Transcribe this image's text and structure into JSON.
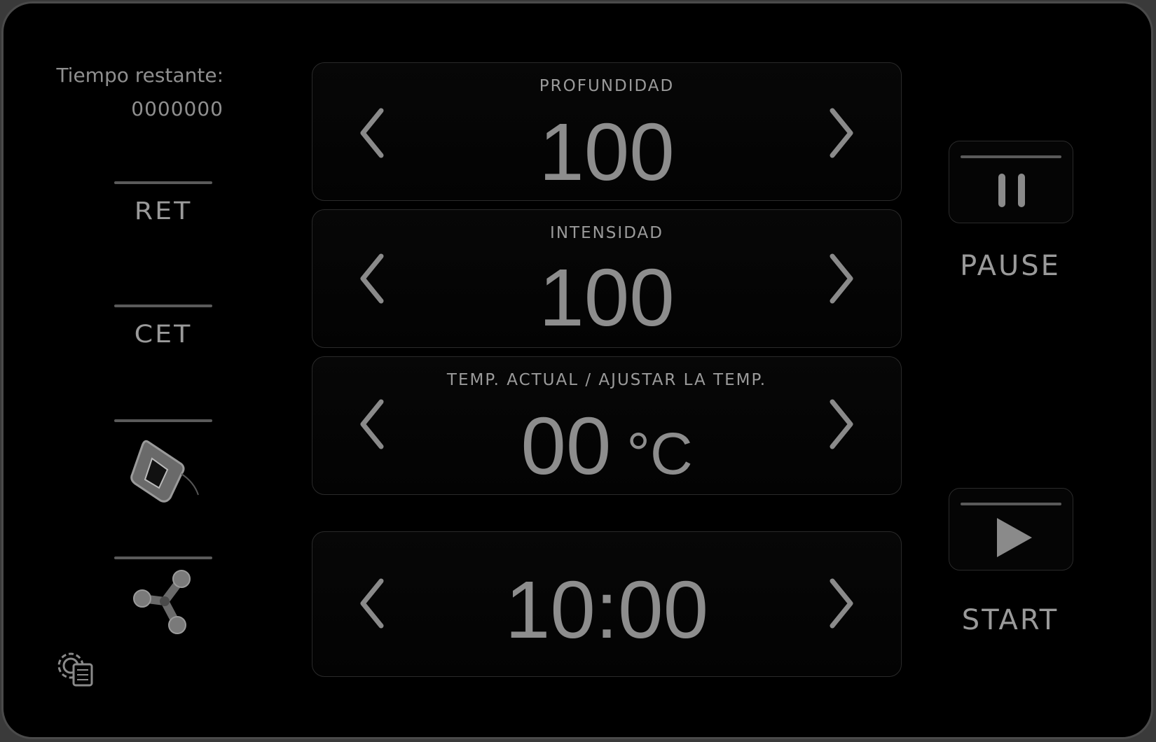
{
  "timer": {
    "label": "Tiempo restante:",
    "value": "0000000"
  },
  "modes": [
    {
      "label": "RET"
    },
    {
      "label": "CET"
    },
    {
      "icon": "handpiece-icon"
    },
    {
      "icon": "tripolar-applicator-icon"
    }
  ],
  "panels": {
    "depth": {
      "label": "PROFUNDIDAD",
      "value": "100"
    },
    "intensity": {
      "label": "INTENSIDAD",
      "value": "100"
    },
    "temperature": {
      "label": "TEMP. ACTUAL / AJUSTAR LA TEMP.",
      "value": "00",
      "unit": "°C"
    },
    "time": {
      "value": "10:00"
    }
  },
  "controls": {
    "pause": {
      "label": "PAUSE",
      "icon": "pause-icon"
    },
    "start": {
      "label": "START",
      "icon": "play-icon"
    }
  },
  "settings": {
    "icon": "settings-gear-icon"
  },
  "colors": {
    "background": "#000000",
    "text": "#8f8f8f",
    "accent_bar": "#5a5a5a"
  }
}
